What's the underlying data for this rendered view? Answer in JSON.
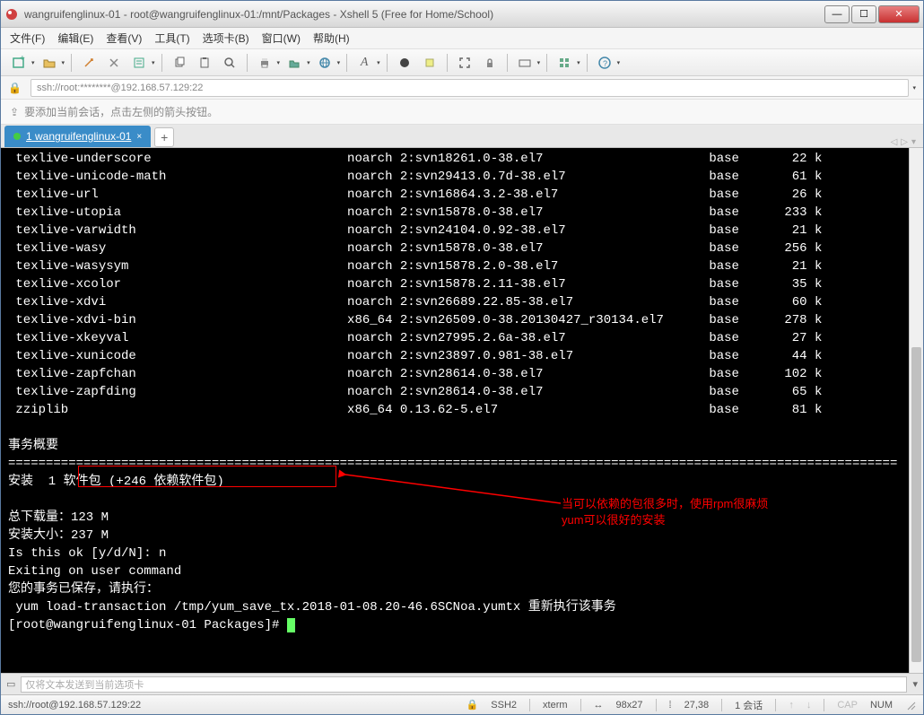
{
  "window": {
    "title": "wangruifenglinux-01 - root@wangruifenglinux-01:/mnt/Packages - Xshell 5 (Free for Home/School)"
  },
  "menu": {
    "file": "文件(F)",
    "edit": "编辑(E)",
    "view": "查看(V)",
    "tools": "工具(T)",
    "tabs": "选项卡(B)",
    "window": "窗口(W)",
    "help": "帮助(H)"
  },
  "addressbar": {
    "text": "ssh://root:********@192.168.57.129:22"
  },
  "hint": {
    "text": "要添加当前会话，点击左侧的箭头按钮。"
  },
  "tab": {
    "label": "1 wangruifenglinux-01"
  },
  "packages": [
    {
      "name": "texlive-underscore",
      "arch": "noarch",
      "version": "2:svn18261.0-38.el7",
      "repo": "base",
      "size": "22 k"
    },
    {
      "name": "texlive-unicode-math",
      "arch": "noarch",
      "version": "2:svn29413.0.7d-38.el7",
      "repo": "base",
      "size": "61 k"
    },
    {
      "name": "texlive-url",
      "arch": "noarch",
      "version": "2:svn16864.3.2-38.el7",
      "repo": "base",
      "size": "26 k"
    },
    {
      "name": "texlive-utopia",
      "arch": "noarch",
      "version": "2:svn15878.0-38.el7",
      "repo": "base",
      "size": "233 k"
    },
    {
      "name": "texlive-varwidth",
      "arch": "noarch",
      "version": "2:svn24104.0.92-38.el7",
      "repo": "base",
      "size": "21 k"
    },
    {
      "name": "texlive-wasy",
      "arch": "noarch",
      "version": "2:svn15878.0-38.el7",
      "repo": "base",
      "size": "256 k"
    },
    {
      "name": "texlive-wasysym",
      "arch": "noarch",
      "version": "2:svn15878.2.0-38.el7",
      "repo": "base",
      "size": "21 k"
    },
    {
      "name": "texlive-xcolor",
      "arch": "noarch",
      "version": "2:svn15878.2.11-38.el7",
      "repo": "base",
      "size": "35 k"
    },
    {
      "name": "texlive-xdvi",
      "arch": "noarch",
      "version": "2:svn26689.22.85-38.el7",
      "repo": "base",
      "size": "60 k"
    },
    {
      "name": "texlive-xdvi-bin",
      "arch": "x86_64",
      "version": "2:svn26509.0-38.20130427_r30134.el7",
      "repo": "base",
      "size": "278 k"
    },
    {
      "name": "texlive-xkeyval",
      "arch": "noarch",
      "version": "2:svn27995.2.6a-38.el7",
      "repo": "base",
      "size": "27 k"
    },
    {
      "name": "texlive-xunicode",
      "arch": "noarch",
      "version": "2:svn23897.0.981-38.el7",
      "repo": "base",
      "size": "44 k"
    },
    {
      "name": "texlive-zapfchan",
      "arch": "noarch",
      "version": "2:svn28614.0-38.el7",
      "repo": "base",
      "size": "102 k"
    },
    {
      "name": "texlive-zapfding",
      "arch": "noarch",
      "version": "2:svn28614.0-38.el7",
      "repo": "base",
      "size": "65 k"
    },
    {
      "name": "zziplib",
      "arch": "x86_64",
      "version": "0.13.62-5.el7",
      "repo": "base",
      "size": "81 k"
    }
  ],
  "term": {
    "summary_header": "事务概要",
    "install_line_prefix": "安装  1 ",
    "install_line_box": "软件包 (+246 依赖软件包)",
    "download_size": "总下载量：123 M",
    "install_size": "安装大小：237 M",
    "prompt_ok": "Is this ok [y/d/N]: n",
    "exiting": "Exiting on user command",
    "saved": "您的事务已保存，请执行：",
    "rerun": " yum load-transaction /tmp/yum_save_tx.2018-01-08.20-46.6SCNoa.yumtx 重新执行该事务",
    "shell_prompt": "[root@wangruifenglinux-01 Packages]# "
  },
  "annotation": {
    "line1": "当可以依赖的包很多时，使用rpm很麻烦",
    "line2": "yum可以很好的安装"
  },
  "sendbar": {
    "placeholder": "仅将文本发送到当前选项卡"
  },
  "status": {
    "conn": "ssh://root@192.168.57.129:22",
    "proto": "SSH2",
    "term": "xterm",
    "size": "98x27",
    "cursor": "27,38",
    "sessions": "1 会话",
    "cap": "CAP",
    "num": "NUM"
  }
}
